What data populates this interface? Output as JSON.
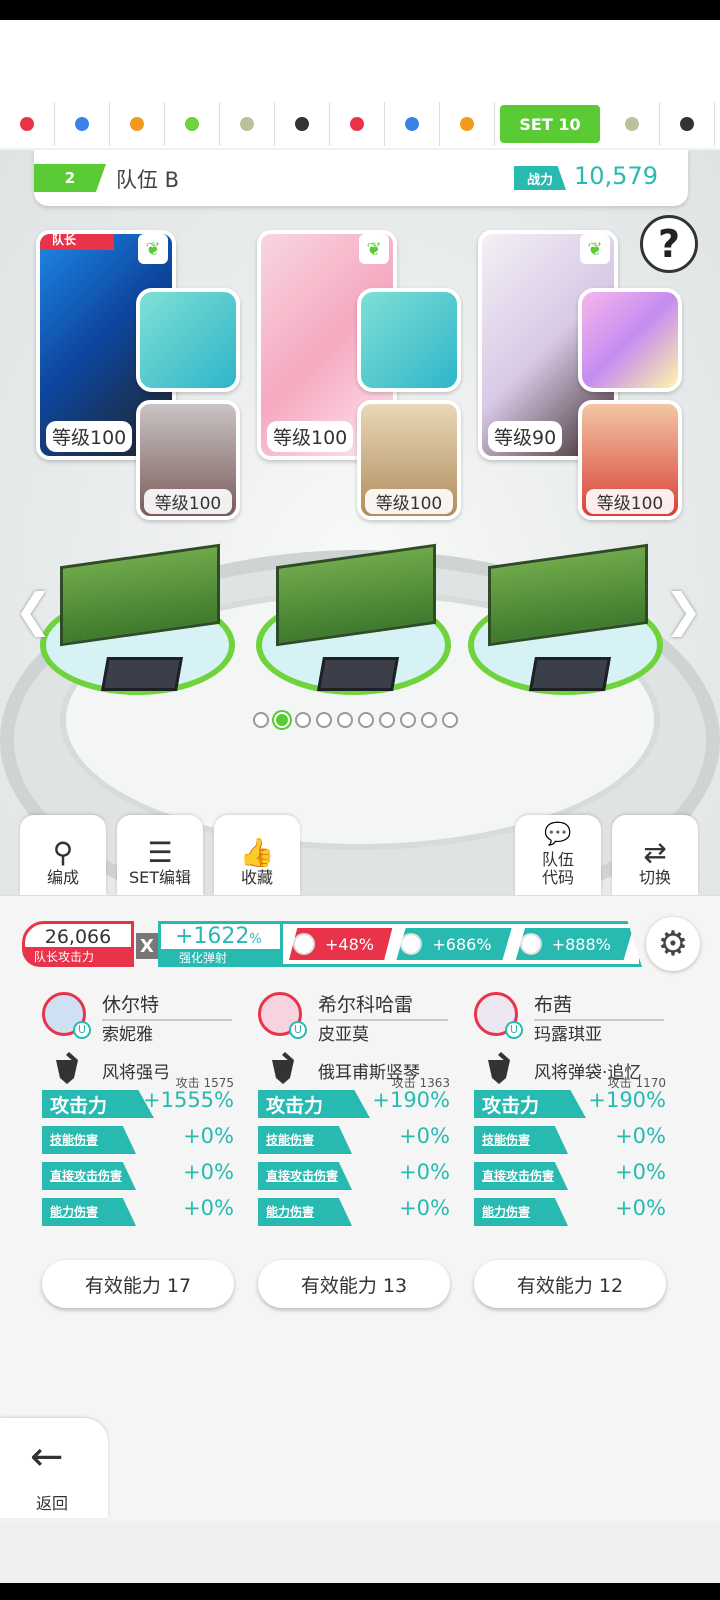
{
  "set_tabs": [
    {
      "color": "#e8334a"
    },
    {
      "color": "#3b82e8"
    },
    {
      "color": "#f29a1e"
    },
    {
      "color": "#6fd33b"
    },
    {
      "color": "#b9c29a"
    },
    {
      "color": "#333333"
    },
    {
      "color": "#e8334a"
    },
    {
      "color": "#3b82e8"
    },
    {
      "color": "#f29a1e"
    },
    {
      "label": "SET 10",
      "active": true
    },
    {
      "color": "#b9c29a"
    },
    {
      "color": "#333333"
    }
  ],
  "team": {
    "number": "2",
    "name": "队伍 B",
    "power_label": "战力",
    "power_value": "10,579"
  },
  "help_label": "?",
  "cards": [
    {
      "leader_badge": "队长",
      "main_level": "等级100",
      "sub_level": "等级100"
    },
    {
      "main_level": "等级100",
      "sub_level": "等级100"
    },
    {
      "main_level": "等级90",
      "sub_level": "等级100"
    }
  ],
  "pager": {
    "count": 10,
    "active_index": 1
  },
  "actions": {
    "formation": "编成",
    "set_edit": "SET编辑",
    "favorite": "收藏",
    "team_code": "队伍\n代码",
    "switch": "切换"
  },
  "summary": {
    "leader_attack_value": "26,066",
    "leader_attack_label": "队长攻击力",
    "x": "X",
    "boost_value": "+1622",
    "boost_unit": "%",
    "boost_label": "强化弹射",
    "multipliers": [
      "+48%",
      "+686%",
      "+888%"
    ]
  },
  "columns": [
    {
      "char_name": "休尔特",
      "sub_name": "索妮雅",
      "weapon": "风将强弓",
      "atk_label": "攻击力",
      "atk_base": "攻击 1575",
      "atk_value": "+1555%",
      "skill_label": "技能伤害",
      "skill_value": "+0%",
      "direct_label": "直接攻击伤害",
      "direct_value": "+0%",
      "ability_label": "能力伤害",
      "ability_value": "+0%",
      "effective": "有效能力 17"
    },
    {
      "char_name": "希尔科哈雷",
      "sub_name": "皮亚莫",
      "weapon": "俄耳甫斯竖琴",
      "atk_label": "攻击力",
      "atk_base": "攻击 1363",
      "atk_value": "+190%",
      "skill_label": "技能伤害",
      "skill_value": "+0%",
      "direct_label": "直接攻击伤害",
      "direct_value": "+0%",
      "ability_label": "能力伤害",
      "ability_value": "+0%",
      "effective": "有效能力 13"
    },
    {
      "char_name": "布茜",
      "sub_name": "玛露琪亚",
      "weapon": "风将弹袋·追忆",
      "atk_label": "攻击力",
      "atk_base": "攻击 1170",
      "atk_value": "+190%",
      "skill_label": "技能伤害",
      "skill_value": "+0%",
      "direct_label": "直接攻击伤害",
      "direct_value": "+0%",
      "ability_label": "能力伤害",
      "ability_value": "+0%",
      "effective": "有效能力 12"
    }
  ],
  "back_label": "返回",
  "colors": {
    "accent_green": "#5acb35",
    "teal": "#28b9b0",
    "red": "#e8334a"
  }
}
